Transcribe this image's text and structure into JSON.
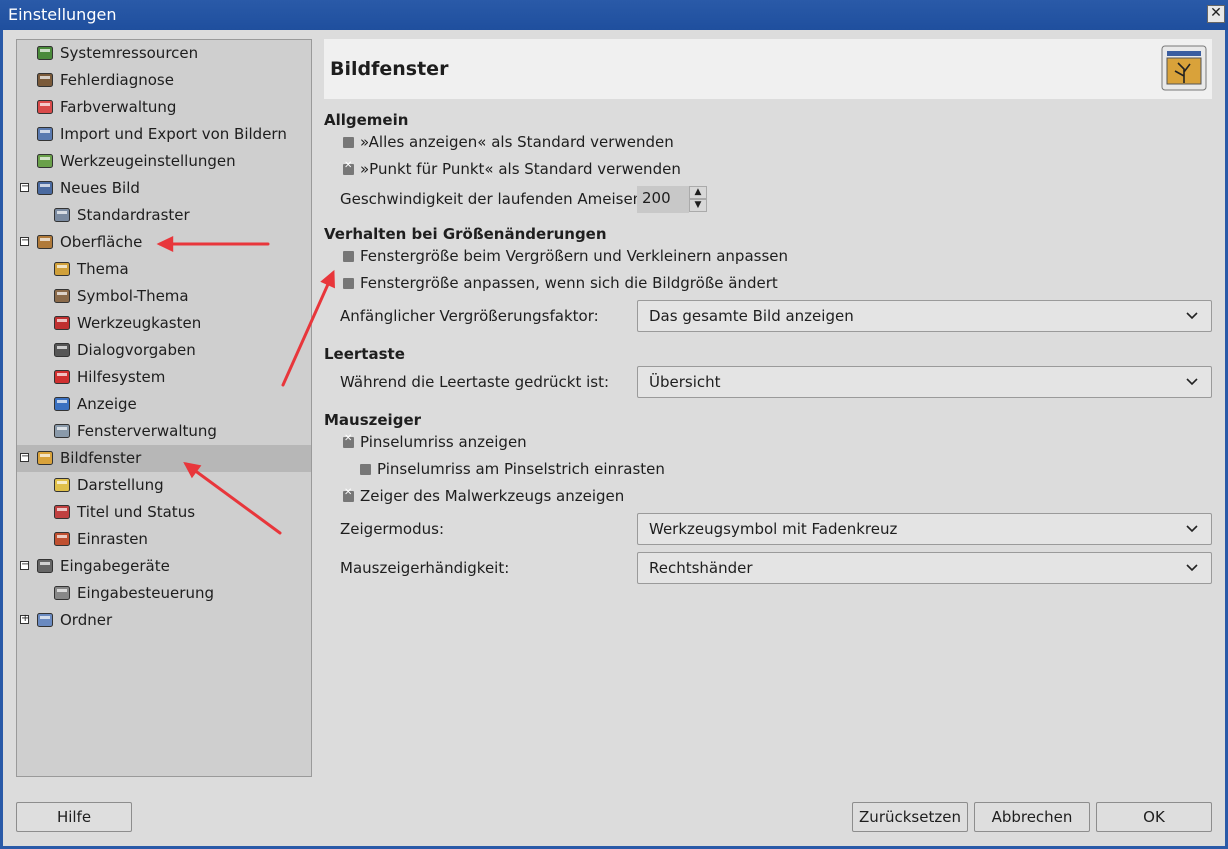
{
  "window": {
    "title": "Einstellungen",
    "close_glyph": "✕"
  },
  "tree": [
    {
      "label": "Systemressourcen",
      "icon": "system-resources-icon",
      "level": 0,
      "expander": ""
    },
    {
      "label": "Fehlerdiagnose",
      "icon": "debug-icon",
      "level": 0,
      "expander": ""
    },
    {
      "label": "Farbverwaltung",
      "icon": "color-management-icon",
      "level": 0,
      "expander": ""
    },
    {
      "label": "Import und Export von Bildern",
      "icon": "import-export-icon",
      "level": 0,
      "expander": ""
    },
    {
      "label": "Werkzeugeinstellungen",
      "icon": "tool-options-icon",
      "level": 0,
      "expander": ""
    },
    {
      "label": "Neues Bild",
      "icon": "new-image-icon",
      "level": 0,
      "expander": "−"
    },
    {
      "label": "Standardraster",
      "icon": "grid-icon",
      "level": 1,
      "expander": ""
    },
    {
      "label": "Oberfläche",
      "icon": "interface-icon",
      "level": 0,
      "expander": "−"
    },
    {
      "label": "Thema",
      "icon": "theme-icon",
      "level": 1,
      "expander": ""
    },
    {
      "label": "Symbol-Thema",
      "icon": "icon-theme-icon",
      "level": 1,
      "expander": ""
    },
    {
      "label": "Werkzeugkasten",
      "icon": "toolbox-icon",
      "level": 1,
      "expander": ""
    },
    {
      "label": "Dialogvorgaben",
      "icon": "dialog-defaults-icon",
      "level": 1,
      "expander": ""
    },
    {
      "label": "Hilfesystem",
      "icon": "help-lifebuoy-icon",
      "level": 1,
      "expander": ""
    },
    {
      "label": "Anzeige",
      "icon": "display-icon",
      "level": 1,
      "expander": ""
    },
    {
      "label": "Fensterverwaltung",
      "icon": "window-management-icon",
      "level": 1,
      "expander": ""
    },
    {
      "label": "Bildfenster",
      "icon": "image-window-icon",
      "level": 0,
      "expander": "−",
      "selected": true
    },
    {
      "label": "Darstellung",
      "icon": "appearance-icon",
      "level": 1,
      "expander": ""
    },
    {
      "label": "Titel und Status",
      "icon": "title-status-icon",
      "level": 1,
      "expander": ""
    },
    {
      "label": "Einrasten",
      "icon": "snap-icon",
      "level": 1,
      "expander": ""
    },
    {
      "label": "Eingabegeräte",
      "icon": "input-devices-icon",
      "level": 0,
      "expander": "−"
    },
    {
      "label": "Eingabesteuerung",
      "icon": "input-controllers-icon",
      "level": 1,
      "expander": ""
    },
    {
      "label": "Ordner",
      "icon": "folders-icon",
      "level": 0,
      "expander": "+"
    }
  ],
  "panel": {
    "title": "Bildfenster",
    "header_icon": "image-window-large-icon",
    "allgemein": {
      "heading": "Allgemein",
      "show_all": {
        "label": "»Alles anzeigen« als Standard verwenden",
        "checked": false
      },
      "dot_for_dot": {
        "label": "»Punkt für Punkt« als Standard verwenden",
        "checked": true
      },
      "ants_label": "Geschwindigkeit der laufenden Ameisen:",
      "ants_value": "200"
    },
    "resize": {
      "heading": "Verhalten bei Größenänderungen",
      "resize_zoom": {
        "label": "Fenstergröße beim Vergrößern und Verkleinern anpassen",
        "checked": false
      },
      "resize_image": {
        "label": "Fenstergröße anpassen, wenn sich die Bildgröße ändert",
        "checked": false
      },
      "zoom_label": "Anfänglicher Vergrößerungsfaktor:",
      "zoom_value": "Das gesamte Bild anzeigen"
    },
    "space": {
      "heading": "Leertaste",
      "label": "Während die Leertaste gedrückt ist:",
      "value": "Übersicht"
    },
    "pointer": {
      "heading": "Mauszeiger",
      "brush_outline": {
        "label": "Pinselumriss anzeigen",
        "checked": true
      },
      "snap_outline": {
        "label": "Pinselumriss am Pinselstrich einrasten",
        "checked": false
      },
      "paint_pointer": {
        "label": "Zeiger des Malwerkzeugs anzeigen",
        "checked": true
      },
      "mode_label": "Zeigermodus:",
      "mode_value": "Werkzeugsymbol mit Fadenkreuz",
      "hand_label": "Mauszeigerhändigkeit:",
      "hand_value": "Rechtshänder"
    }
  },
  "buttons": {
    "help": "Hilfe",
    "reset": "Zurücksetzen",
    "cancel": "Abbrechen",
    "ok": "OK"
  },
  "annotation_color": "#e8363b"
}
